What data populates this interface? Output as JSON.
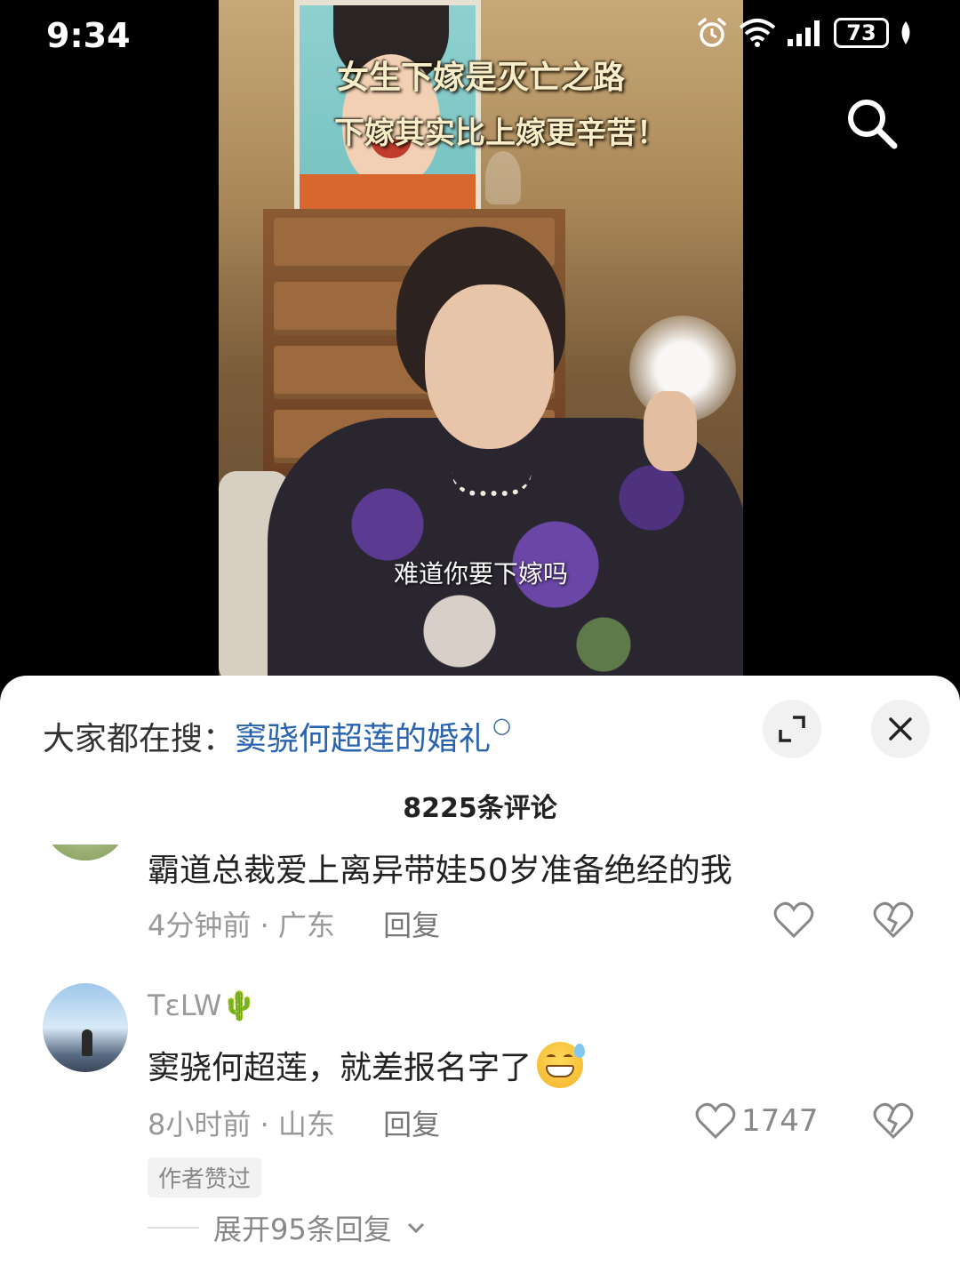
{
  "status_bar": {
    "time": "9:34",
    "battery": "73",
    "icons": [
      "alarm-icon",
      "wifi-icon",
      "signal-icon",
      "battery-icon",
      "leaf-icon"
    ]
  },
  "video": {
    "headline_line1": "女生下嫁是灭亡之路",
    "headline_line2": "下嫁其实比上嫁更辛苦！",
    "subtitle": "难道你要下嫁吗",
    "search_icon": "search-icon"
  },
  "comment_sheet": {
    "trending_label": "大家都在搜：",
    "trending_query": "窦骁何超莲的婚礼",
    "expand_icon": "expand-icon",
    "close_icon": "close-icon",
    "comment_count": "8225条评论",
    "comments": [
      {
        "text": "霸道总裁爱上离异带娃50岁准备绝经的我",
        "time": "4分钟前",
        "location": "广东",
        "reply_label": "回复",
        "likes": ""
      },
      {
        "username": "TεLW🌵",
        "text": "窦骁何超莲，就差报名字了",
        "time": "8小时前",
        "location": "山东",
        "reply_label": "回复",
        "likes": "1747",
        "author_badge": "作者赞过",
        "expand_replies": "展开95条回复"
      }
    ],
    "colors": {
      "link": "#2a63b0",
      "meta": "#999999",
      "sheet_bg": "#ffffff"
    }
  }
}
